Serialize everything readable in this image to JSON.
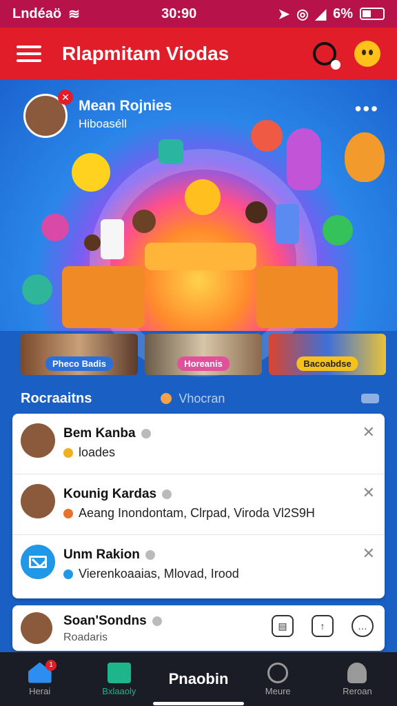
{
  "status_bar": {
    "carrier": "Lndéaö",
    "time": "30:90",
    "battery": "6%"
  },
  "app_bar": {
    "title": "Rlapmitam Viodas"
  },
  "hero": {
    "user_name": "Mean Rojnies",
    "subtitle": "Hiboaséll",
    "avatar_badge": "✕",
    "more": "•••"
  },
  "thumbnails": [
    {
      "tag": "Pheco Badis",
      "color": "#2a6fdc"
    },
    {
      "tag": "Horeanis",
      "color": "#e0519b"
    },
    {
      "tag": "Bacoabdse",
      "color": "#f5c21b"
    }
  ],
  "section": {
    "title": "Rocraaitns",
    "tab": "Vhocran"
  },
  "list": [
    {
      "name": "Bem Kanba",
      "sub": "loades",
      "sub_color": "#f0b020"
    },
    {
      "name": "Kounig Kardas",
      "sub": "Aeang Inondontam, Clrpad, Viroda Vl2S9H",
      "sub_color": "#e8742b"
    },
    {
      "name": "Unm Rakion",
      "sub": "Vierenkoaaias, Mlovad, Irood",
      "sub_color": "#2197e8"
    }
  ],
  "last_item": {
    "name": "Soan'Sondns",
    "sub": "Roadaris"
  },
  "bottom_nav": [
    {
      "label": "Herai",
      "badge": "1"
    },
    {
      "label": "Bxlaaoly"
    },
    {
      "label": "Pnaobin"
    },
    {
      "label": "Meure"
    },
    {
      "label": "Reroan"
    }
  ]
}
